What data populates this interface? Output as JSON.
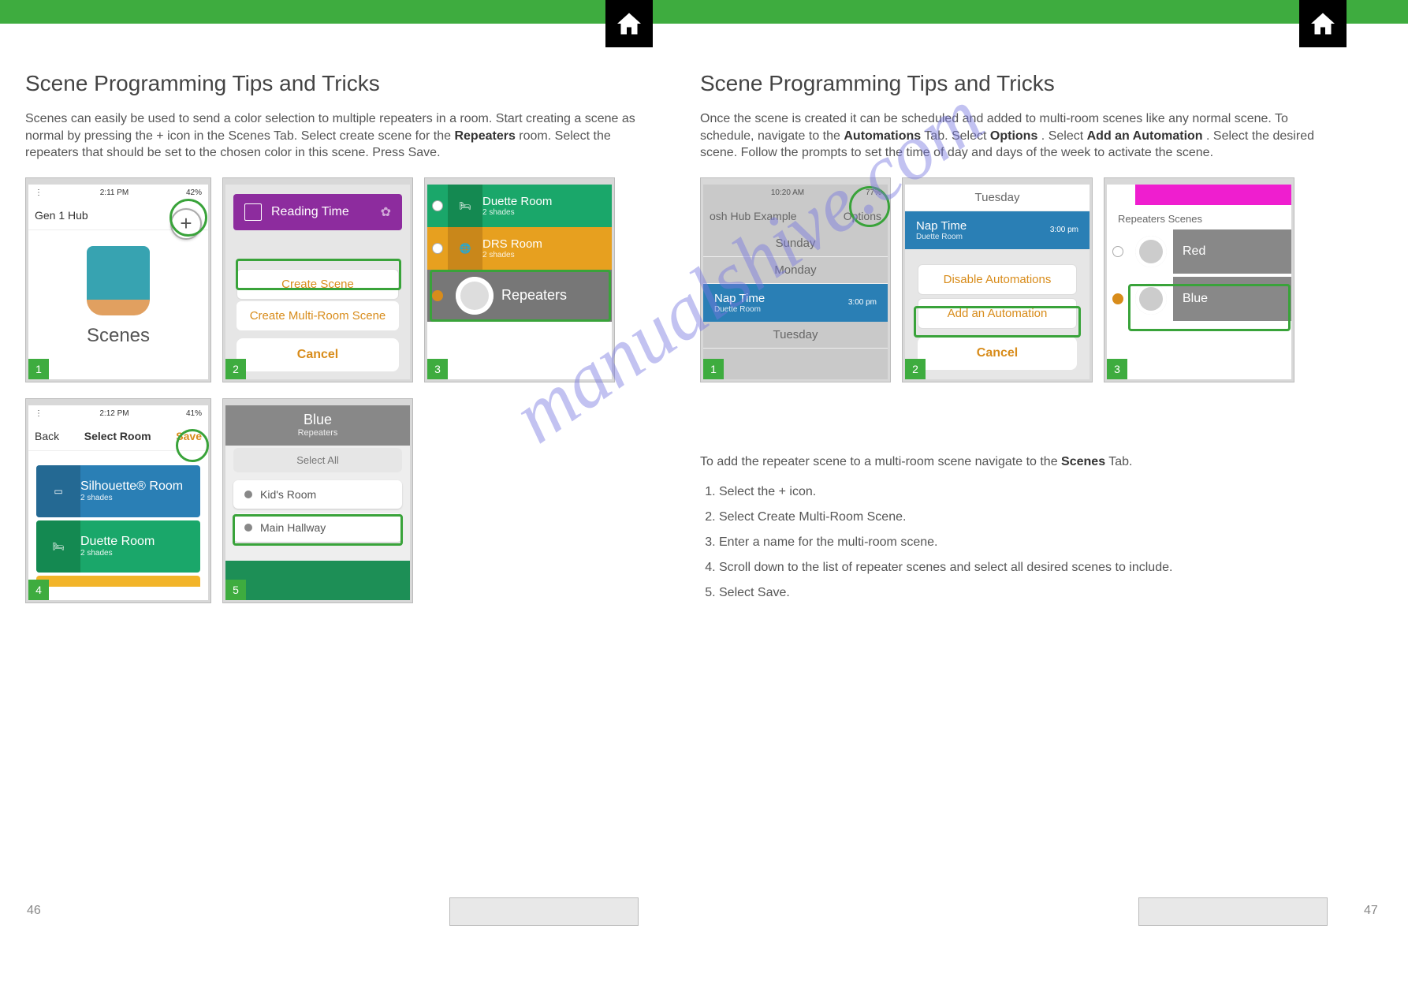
{
  "watermark": "manualshive.com",
  "pages": {
    "left": {
      "heading": "Scene Programming Tips and Tricks",
      "intro_prefix": "Scenes can easily be used to send a color selection to multiple repeaters in a room. Start creating a scene as normal by pressing the + icon in the Scenes Tab. Select create scene for the ",
      "intro_bold": "Repeaters",
      "intro_suffix": " room. Select the repeaters that should be set to the chosen color in this scene. Press Save.",
      "shots": [
        {
          "badge": "1",
          "status_time": "2:11 PM",
          "status_right": "42%",
          "nav_left": "Gen 1 Hub",
          "plus": "+",
          "label": "Scenes"
        },
        {
          "badge": "2",
          "reading": "Reading Time",
          "create_scene": "Create Scene",
          "create_multi": "Create Multi-Room Scene",
          "cancel": "Cancel"
        },
        {
          "badge": "3",
          "rooms": [
            {
              "name": "Duette Room",
              "sub": "2 shades",
              "color": "#1aa76a"
            },
            {
              "name": "DRS Room",
              "sub": "2 shades",
              "color": "#e7a01f"
            }
          ],
          "repeaters": "Repeaters"
        },
        {
          "badge": "4",
          "status_time": "2:12 PM",
          "status_right": "41%",
          "nav_left": "Back",
          "nav_center": "Select Room",
          "nav_right": "Save",
          "cards": [
            {
              "name": "Silhouette® Room",
              "sub": "2 shades",
              "color": "#2a7fb5",
              "icbg": "#246993"
            },
            {
              "name": "Duette Room",
              "sub": "2 shades",
              "color": "#1aa76a",
              "icbg": "#148951"
            }
          ]
        },
        {
          "badge": "5",
          "hdr_title": "Blue",
          "hdr_sub": "Repeaters",
          "select_all": "Select All",
          "items": [
            "Kid's Room",
            "Main Hallway"
          ]
        }
      ]
    },
    "right": {
      "heading": "Scene Programming Tips and Tricks",
      "para1_prefix": "Once the scene is created it can be scheduled and added to multi-room scenes like any normal scene. To schedule, navigate to the ",
      "para1_b1": "Automations",
      "para1_mid": " Tab. Select ",
      "para1_b2": "Options",
      "para1_mid2": ". Select ",
      "para1_b3": "Add an Automation",
      "para1_suffix": ". Select the desired scene. Follow the prompts to set the time of day and days of the week to activate the scene.",
      "shots": [
        {
          "badge": "1",
          "status_time": "10:20 AM",
          "status_right": "77%",
          "nav_left": "osh Hub Example",
          "nav_right": "Options",
          "days": [
            "Sunday",
            "Monday"
          ],
          "auto": {
            "name": "Nap Time",
            "sub": "Duette Room",
            "time": "3:00 pm"
          },
          "day_after": "Tuesday"
        },
        {
          "badge": "2",
          "day": "Tuesday",
          "auto": {
            "name": "Nap Time",
            "sub": "Duette Room",
            "time": "3:00 pm"
          },
          "disable": "Disable Automations",
          "add": "Add an Automation",
          "cancel": "Cancel"
        },
        {
          "badge": "3",
          "tag": "Repeaters Scenes",
          "items": [
            {
              "name": "Red",
              "checked": false
            },
            {
              "name": "Blue",
              "checked": true
            }
          ]
        }
      ],
      "list_intro_prefix": "To add the repeater scene to a multi-room scene navigate to the ",
      "list_intro_b1": "Scenes",
      "list_intro_suffix": " Tab.",
      "steps": [
        "Select the + icon.",
        "Select Create Multi-Room Scene.",
        "Enter a name for the multi-room scene.",
        "Scroll down to the list of repeater scenes and select all desired scenes to include.",
        "Select Save."
      ]
    }
  },
  "footer": {
    "left_page": "46",
    "right_page": "47"
  }
}
